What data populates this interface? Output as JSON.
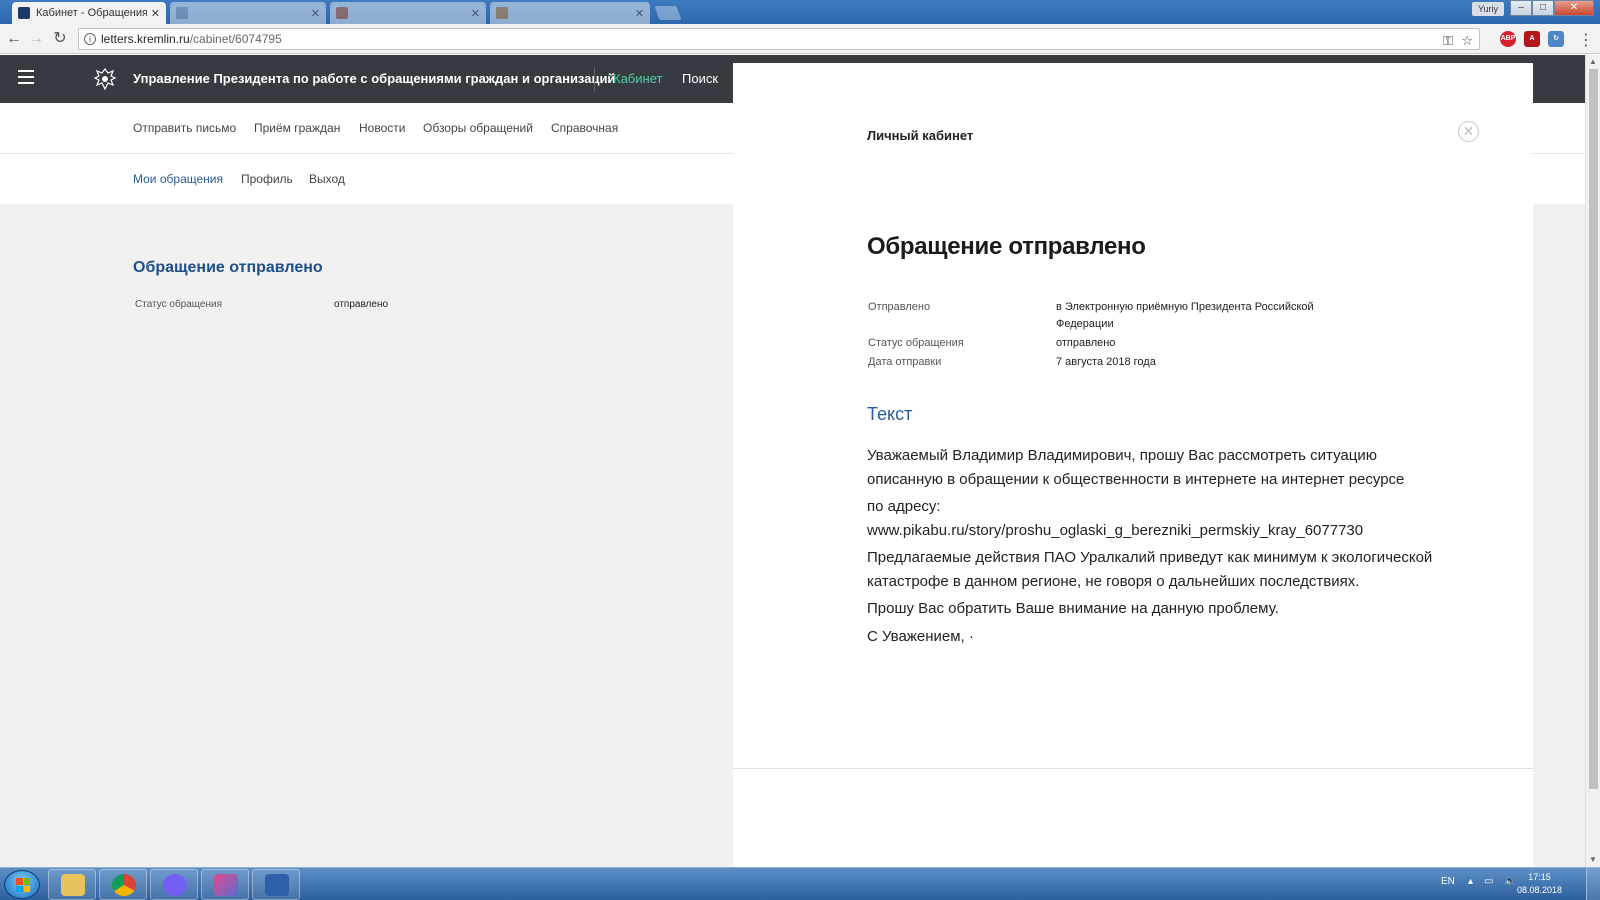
{
  "browser": {
    "tabs": [
      {
        "label": "Кабинет - Обращения гр",
        "active": true
      },
      {
        "label": "",
        "active": false
      },
      {
        "label": "",
        "active": false
      },
      {
        "label": "",
        "active": false
      }
    ],
    "user_label": "Yuriy",
    "url_domain": "letters.kremlin.ru",
    "url_path": "/cabinet/6074795"
  },
  "site": {
    "title": "Управление Президента по работе с обращениями граждан и организаций",
    "header_links": {
      "cabinet": "Кабинет",
      "search": "Поиск"
    },
    "active_color": "#4fd0a8",
    "subnav": [
      "Отправить письмо",
      "Приём граждан",
      "Новости",
      "Обзоры обращений",
      "Справочная"
    ],
    "usernav": [
      "Мои обращения",
      "Профиль",
      "Выход"
    ]
  },
  "left": {
    "heading": "Обращение отправлено",
    "status_label": "Статус обращения",
    "status_value": "отправлено"
  },
  "modal": {
    "title": "Личный кабинет",
    "close_icon": "circle-x",
    "heading": "Обращение отправлено",
    "details": [
      {
        "label": "Отправлено",
        "value": "в Электронную приёмную Президента Российской Федерации"
      },
      {
        "label": "Статус обращения",
        "value": "отправлено"
      },
      {
        "label": "Дата отправки",
        "value": "7 августа 2018 года"
      }
    ],
    "section_title": "Текст",
    "letter": [
      "Уважаемый Владимир Владимирович, прошу Вас рассмотреть ситуацию описанную в обращении к общественности в интернете на интернет ресурсе",
      "по адресу:",
      "www.pikabu.ru/story/proshu_oglaski_g_berezniki_permskiy_kray_6077730",
      "Предлагаемые действия ПАО Уралкалий приведут как минимум к экологической катастрофе в данном регионе, не говоря о дальнейших последствиях.",
      "Прошу Вас обратить Ваше внимание на данную проблему.",
      "С Уважением, ·"
    ]
  },
  "taskbar": {
    "apps": [
      "file-explorer",
      "chrome",
      "viber",
      "mail",
      "other-app"
    ],
    "language": "EN",
    "time": "17:15",
    "date": "08.08.2018"
  }
}
